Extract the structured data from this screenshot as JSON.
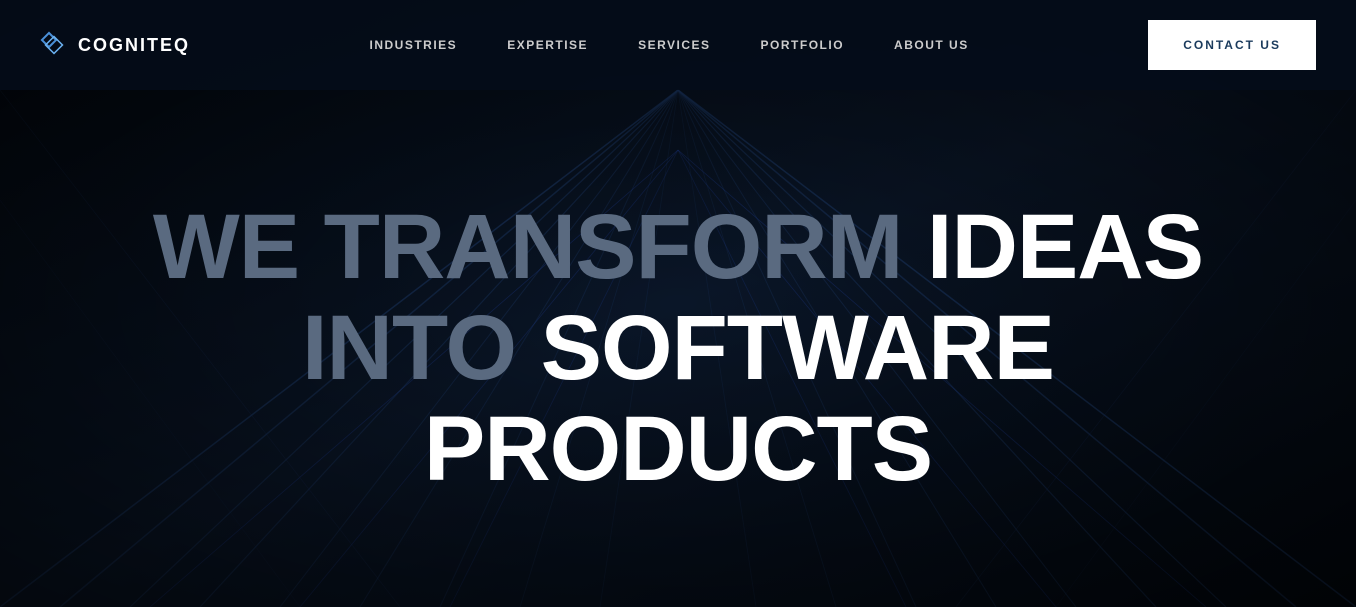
{
  "logo": {
    "text": "COGNITEQ"
  },
  "nav": {
    "items": [
      {
        "label": "INDUSTRIES",
        "href": "#"
      },
      {
        "label": "EXPERTISE",
        "href": "#"
      },
      {
        "label": "SERVICES",
        "href": "#"
      },
      {
        "label": "PORTFOLIO",
        "href": "#"
      },
      {
        "label": "ABOUT US",
        "href": "#"
      }
    ],
    "contact_button": "CONTACT US"
  },
  "hero": {
    "line1_dim": "WE TRANSFORM ",
    "line1_bright": "IDEAS",
    "line2_dim": "INTO ",
    "line2_bright": "SOFTWARE PRODUCTS"
  },
  "colors": {
    "background": "#050d1a",
    "accent_lines": "#1a3a6a",
    "text_dim": "#5a6a80",
    "text_bright": "#ffffff",
    "contact_btn_bg": "#ffffff",
    "contact_btn_text": "#1a3a5c"
  }
}
